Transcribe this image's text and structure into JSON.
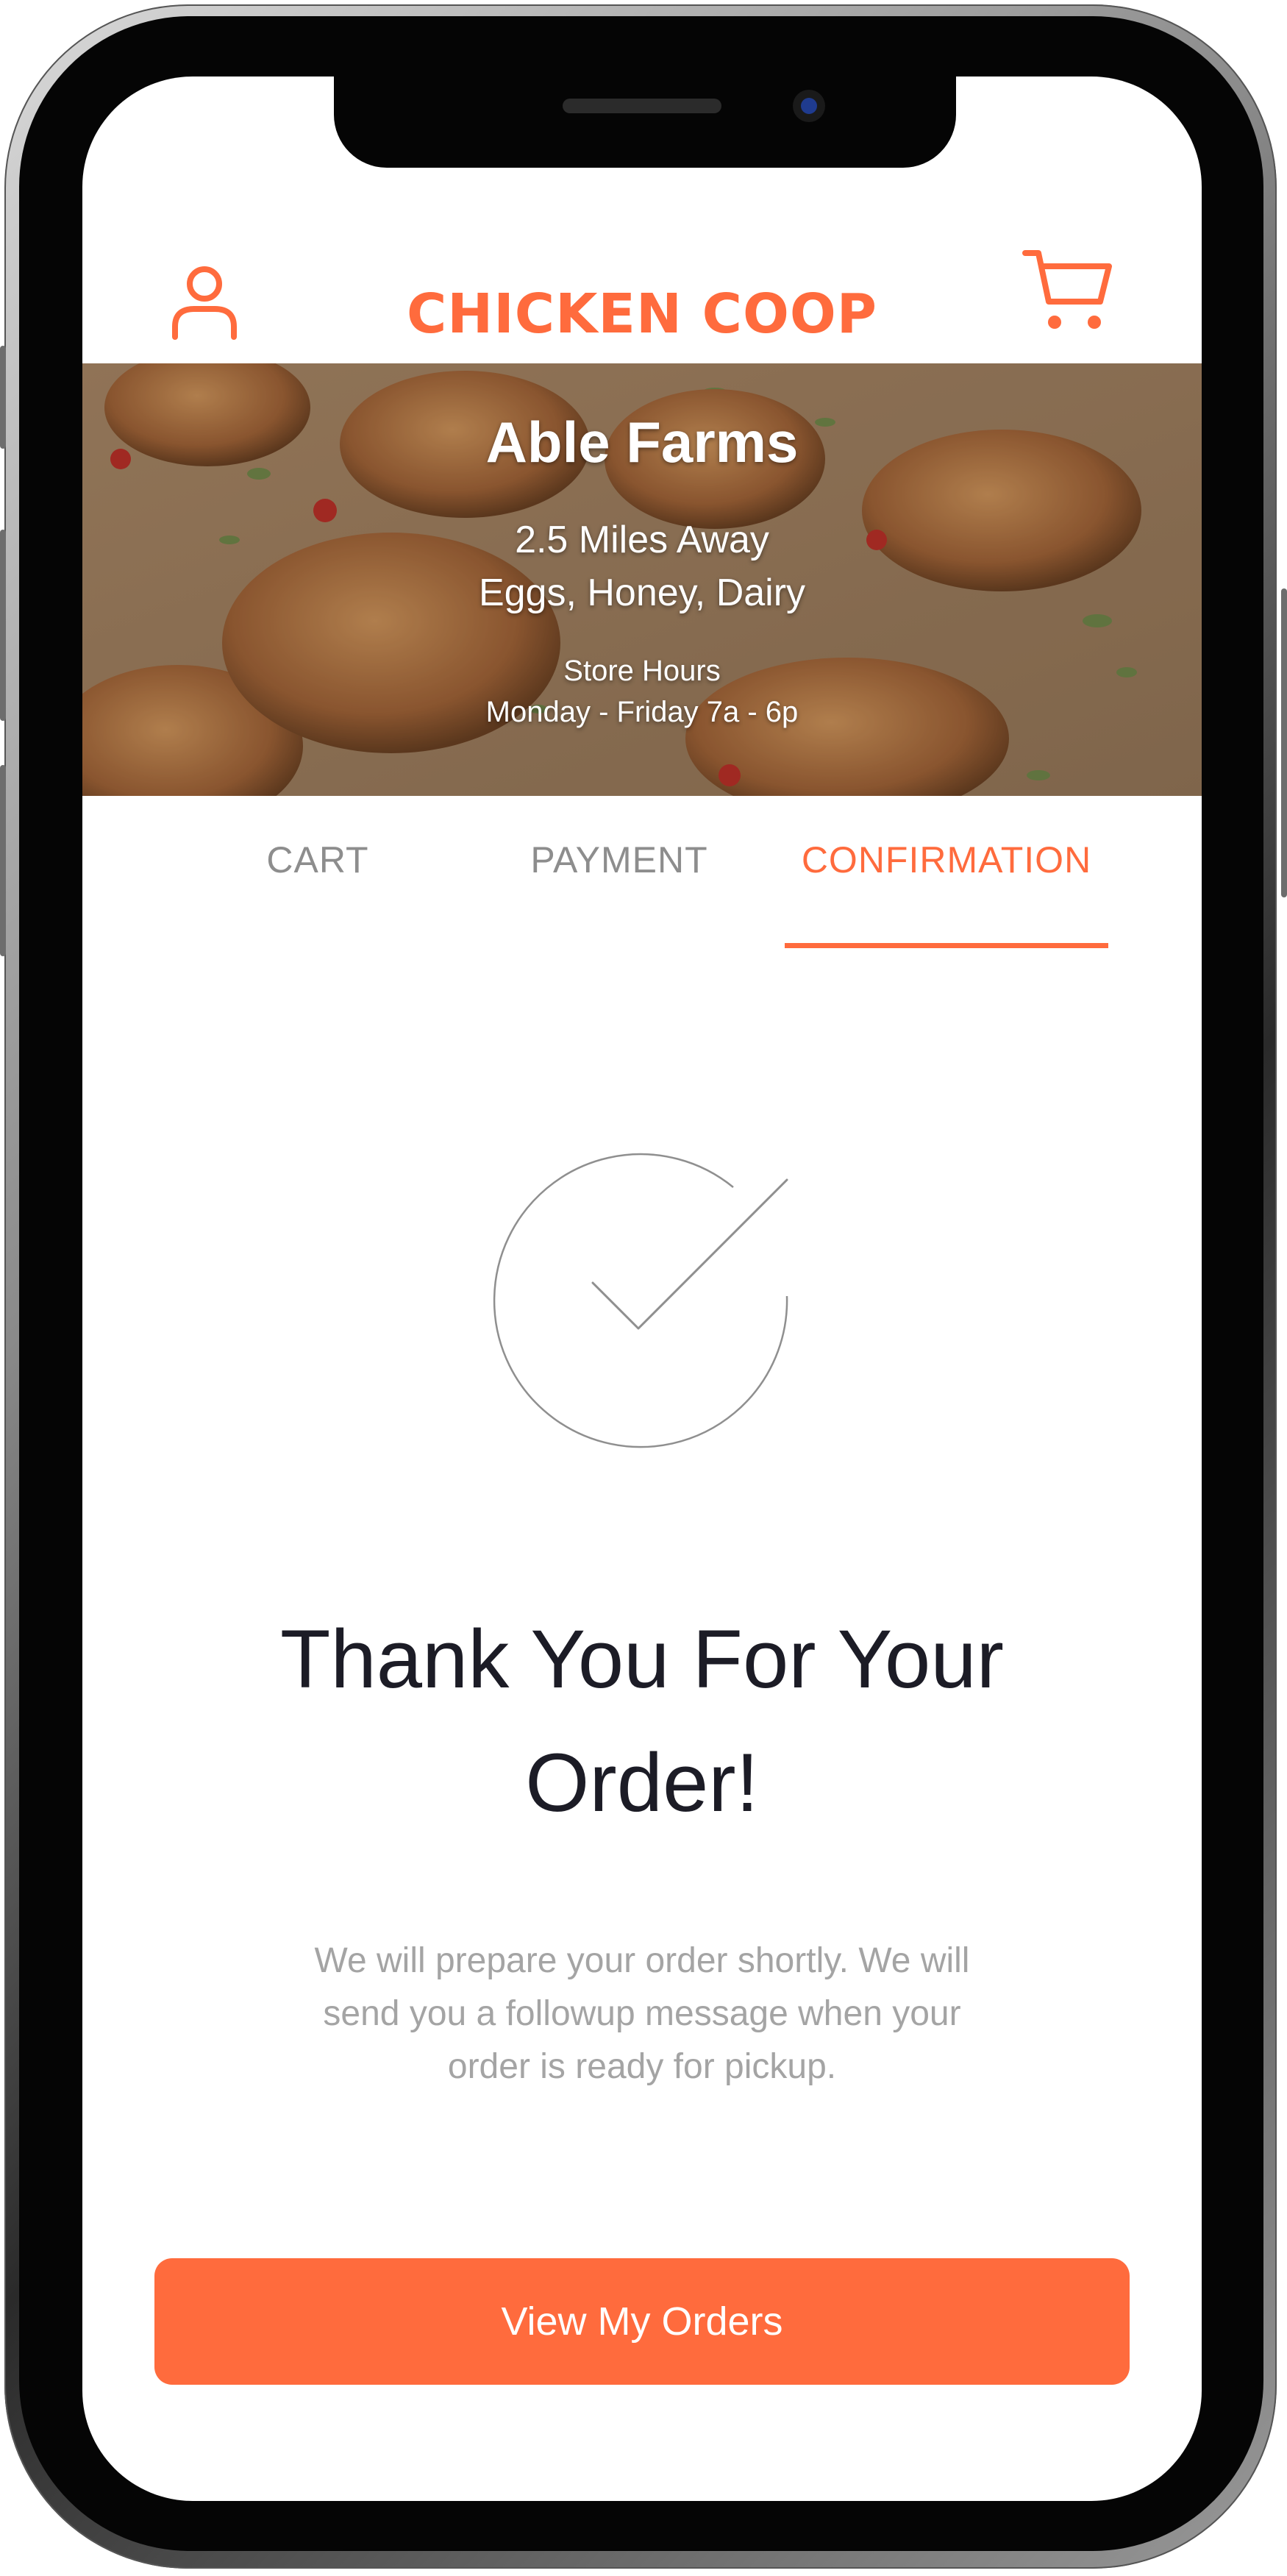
{
  "app": {
    "brand": "CHICKEN COOP"
  },
  "header": {
    "profile_icon": "user-icon",
    "cart_icon": "cart-icon"
  },
  "banner": {
    "farm_name": "Able Farms",
    "distance": "2.5 Miles Away",
    "products": "Eggs, Honey, Dairy",
    "hours_label": "Store Hours",
    "hours_value": "Monday - Friday 7a - 6p"
  },
  "tabs": [
    {
      "label": "CART",
      "active": false
    },
    {
      "label": "PAYMENT",
      "active": false
    },
    {
      "label": "CONFIRMATION",
      "active": true
    }
  ],
  "confirmation": {
    "icon": "checkmark-circle-icon",
    "title_line1": "Thank You For Your",
    "title_line2": "Order!",
    "message_line1": "We will prepare your order shortly. We will",
    "message_line2": "send you a followup message when your",
    "message_line3": "order is ready for pickup."
  },
  "actions": {
    "view_orders_label": "View My Orders"
  },
  "colors": {
    "accent": "#ff6b3d",
    "title": "#1c1c26",
    "muted": "#a4a4a4",
    "tab_inactive": "#8d8d8d"
  }
}
